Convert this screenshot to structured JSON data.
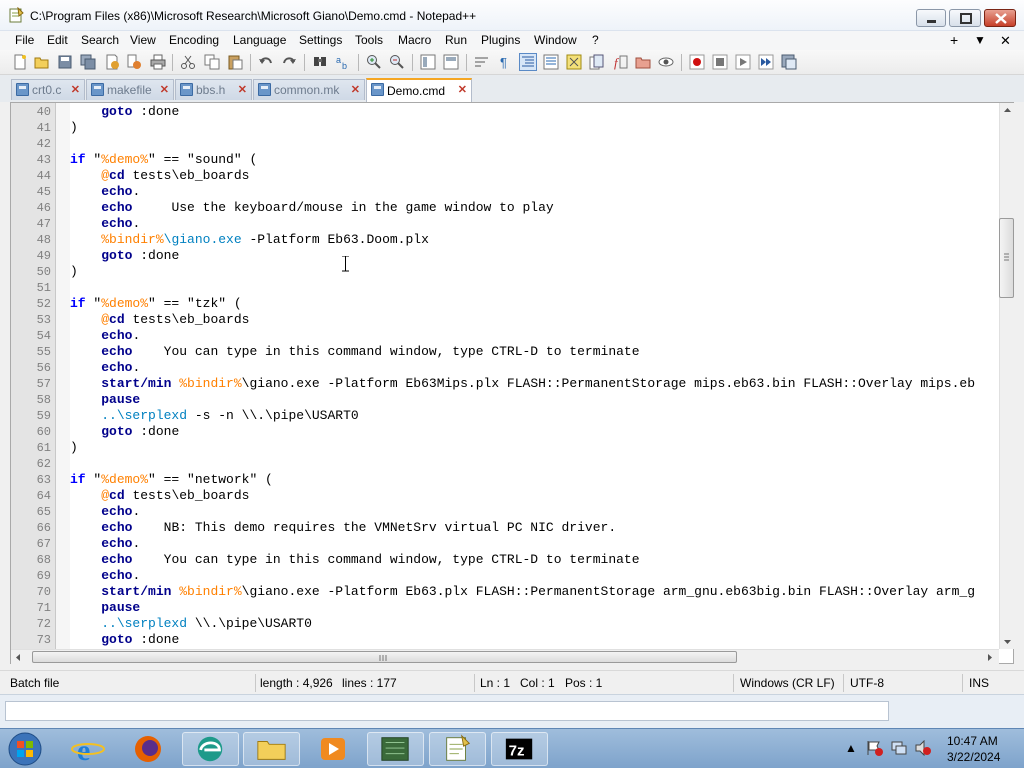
{
  "window": {
    "title": "C:\\Program Files (x86)\\Microsoft Research\\Microsoft Giano\\Demo.cmd - Notepad++"
  },
  "menu": {
    "items": [
      "File",
      "Edit",
      "Search",
      "View",
      "Encoding",
      "Language",
      "Settings",
      "Tools",
      "Macro",
      "Run",
      "Plugins",
      "Window",
      "?"
    ],
    "right": [
      "+",
      "▼",
      "✕"
    ]
  },
  "tabs": [
    {
      "label": "crt0.c",
      "active": false
    },
    {
      "label": "makefile",
      "active": false
    },
    {
      "label": "bbs.h",
      "active": false
    },
    {
      "label": "common.mk",
      "active": false
    },
    {
      "label": "Demo.cmd",
      "active": true
    }
  ],
  "editor": {
    "line_numbers": [
      "40",
      "41",
      "42",
      "43",
      "44",
      "45",
      "46",
      "47",
      "48",
      "49",
      "50",
      "51",
      "52",
      "53",
      "54",
      "55",
      "56",
      "57",
      "58",
      "59",
      "60",
      "61",
      "62",
      "63",
      "64",
      "65",
      "66",
      "67",
      "68",
      "69",
      "70",
      "71",
      "72",
      "73"
    ],
    "lines": [
      [
        {
          "t": "    "
        },
        {
          "t": "goto",
          "c": "cmd"
        },
        {
          "t": " :done"
        }
      ],
      [
        {
          "t": ")"
        }
      ],
      [
        {
          "t": ""
        }
      ],
      [
        {
          "t": "if",
          "c": "kw"
        },
        {
          "t": " \""
        },
        {
          "t": "%demo%",
          "c": "var"
        },
        {
          "t": "\" == \"sound\" ("
        }
      ],
      [
        {
          "t": "    "
        },
        {
          "t": "@",
          "c": "var"
        },
        {
          "t": "cd",
          "c": "cmd"
        },
        {
          "t": " tests\\eb_boards"
        }
      ],
      [
        {
          "t": "    "
        },
        {
          "t": "echo",
          "c": "cmd"
        },
        {
          "t": "."
        }
      ],
      [
        {
          "t": "    "
        },
        {
          "t": "echo",
          "c": "cmd"
        },
        {
          "t": "     Use the keyboard/mouse in the game window to play"
        }
      ],
      [
        {
          "t": "    "
        },
        {
          "t": "echo",
          "c": "cmd"
        },
        {
          "t": "."
        }
      ],
      [
        {
          "t": "    "
        },
        {
          "t": "%bindir%",
          "c": "var"
        },
        {
          "t": "\\giano.exe",
          "c": "path"
        },
        {
          "t": " -Platform Eb63.Doom.plx"
        }
      ],
      [
        {
          "t": "    "
        },
        {
          "t": "goto",
          "c": "cmd"
        },
        {
          "t": " :done"
        }
      ],
      [
        {
          "t": ")"
        }
      ],
      [
        {
          "t": ""
        }
      ],
      [
        {
          "t": "if",
          "c": "kw"
        },
        {
          "t": " \""
        },
        {
          "t": "%demo%",
          "c": "var"
        },
        {
          "t": "\" == \"tzk\" ("
        }
      ],
      [
        {
          "t": "    "
        },
        {
          "t": "@",
          "c": "var"
        },
        {
          "t": "cd",
          "c": "cmd"
        },
        {
          "t": " tests\\eb_boards"
        }
      ],
      [
        {
          "t": "    "
        },
        {
          "t": "echo",
          "c": "cmd"
        },
        {
          "t": "."
        }
      ],
      [
        {
          "t": "    "
        },
        {
          "t": "echo",
          "c": "cmd"
        },
        {
          "t": "    You can type in this command window, type CTRL-D to terminate"
        }
      ],
      [
        {
          "t": "    "
        },
        {
          "t": "echo",
          "c": "cmd"
        },
        {
          "t": "."
        }
      ],
      [
        {
          "t": "    "
        },
        {
          "t": "start/min",
          "c": "cmd"
        },
        {
          "t": " "
        },
        {
          "t": "%bindir%",
          "c": "var"
        },
        {
          "t": "\\giano.exe -Platform Eb63Mips.plx FLASH::PermanentStorage mips.eb63.bin FLASH::Overlay mips.eb"
        }
      ],
      [
        {
          "t": "    "
        },
        {
          "t": "pause",
          "c": "cmd"
        }
      ],
      [
        {
          "t": "    "
        },
        {
          "t": "..\\serplexd",
          "c": "path"
        },
        {
          "t": " -s -n \\\\.\\pipe\\USART0"
        }
      ],
      [
        {
          "t": "    "
        },
        {
          "t": "goto",
          "c": "cmd"
        },
        {
          "t": " :done"
        }
      ],
      [
        {
          "t": ")"
        }
      ],
      [
        {
          "t": ""
        }
      ],
      [
        {
          "t": "if",
          "c": "kw"
        },
        {
          "t": " \""
        },
        {
          "t": "%demo%",
          "c": "var"
        },
        {
          "t": "\" == \"network\" ("
        }
      ],
      [
        {
          "t": "    "
        },
        {
          "t": "@",
          "c": "var"
        },
        {
          "t": "cd",
          "c": "cmd"
        },
        {
          "t": " tests\\eb_boards"
        }
      ],
      [
        {
          "t": "    "
        },
        {
          "t": "echo",
          "c": "cmd"
        },
        {
          "t": "."
        }
      ],
      [
        {
          "t": "    "
        },
        {
          "t": "echo",
          "c": "cmd"
        },
        {
          "t": "    NB: This demo requires the VMNetSrv virtual PC NIC driver."
        }
      ],
      [
        {
          "t": "    "
        },
        {
          "t": "echo",
          "c": "cmd"
        },
        {
          "t": "."
        }
      ],
      [
        {
          "t": "    "
        },
        {
          "t": "echo",
          "c": "cmd"
        },
        {
          "t": "    You can type in this command window, type CTRL-D to terminate"
        }
      ],
      [
        {
          "t": "    "
        },
        {
          "t": "echo",
          "c": "cmd"
        },
        {
          "t": "."
        }
      ],
      [
        {
          "t": "    "
        },
        {
          "t": "start/min",
          "c": "cmd"
        },
        {
          "t": " "
        },
        {
          "t": "%bindir%",
          "c": "var"
        },
        {
          "t": "\\giano.exe -Platform Eb63.plx FLASH::PermanentStorage arm_gnu.eb63big.bin FLASH::Overlay arm_g"
        }
      ],
      [
        {
          "t": "    "
        },
        {
          "t": "pause",
          "c": "cmd"
        }
      ],
      [
        {
          "t": "    "
        },
        {
          "t": "..\\serplexd",
          "c": "path"
        },
        {
          "t": " \\\\.\\pipe\\USART0"
        }
      ],
      [
        {
          "t": "    "
        },
        {
          "t": "goto",
          "c": "cmd"
        },
        {
          "t": " :done"
        }
      ]
    ]
  },
  "status": {
    "file_type": "Batch file",
    "length": "length : 4,926",
    "lines": "lines : 177",
    "ln": "Ln : 1",
    "col": "Col : 1",
    "pos": "Pos : 1",
    "eol": "Windows (CR LF)",
    "encoding": "UTF-8",
    "mode": "INS"
  },
  "taskbar": {
    "time": "10:47 AM",
    "date": "3/22/2024"
  },
  "colors": {
    "keyword": "#0000ff",
    "command": "#00008b",
    "variable": "#ff8000",
    "path": "#0080c0",
    "active_tab_accent": "#f5a623"
  }
}
